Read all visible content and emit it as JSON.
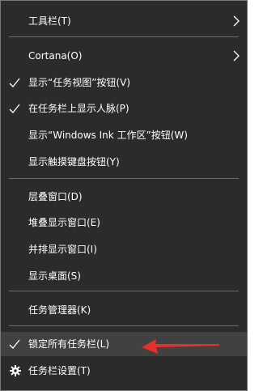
{
  "menu": {
    "toolbars": "工具栏(T)",
    "cortana": "Cortana(O)",
    "show_task_view": "显示“任务视图”按钮(V)",
    "show_people": "在任务栏上显示人脉(P)",
    "show_windows_ink": "显示“Windows Ink 工作区”按钮(W)",
    "show_touch_keyboard": "显示触摸键盘按钮(Y)",
    "cascade": "层叠窗口(D)",
    "stacked": "堆叠显示窗口(E)",
    "side_by_side": "并排显示窗口(I)",
    "show_desktop": "显示桌面(S)",
    "task_manager": "任务管理器(K)",
    "lock_taskbar": "锁定所有任务栏(L)",
    "taskbar_settings": "任务栏设置(T)"
  },
  "checked_items": [
    "show_task_view",
    "show_people",
    "lock_taskbar"
  ],
  "highlighted_item": "lock_taskbar",
  "colors": {
    "menu_bg": "#2b2b2b",
    "highlight_bg": "#414141",
    "text": "#ffffff",
    "separator": "#6a6a6a",
    "annotation_arrow": "#e8302a"
  },
  "icons": {
    "submenu": "chevron-right-icon",
    "check": "checkmark-icon",
    "settings": "gear-icon",
    "annotation": "red-arrow-icon"
  }
}
